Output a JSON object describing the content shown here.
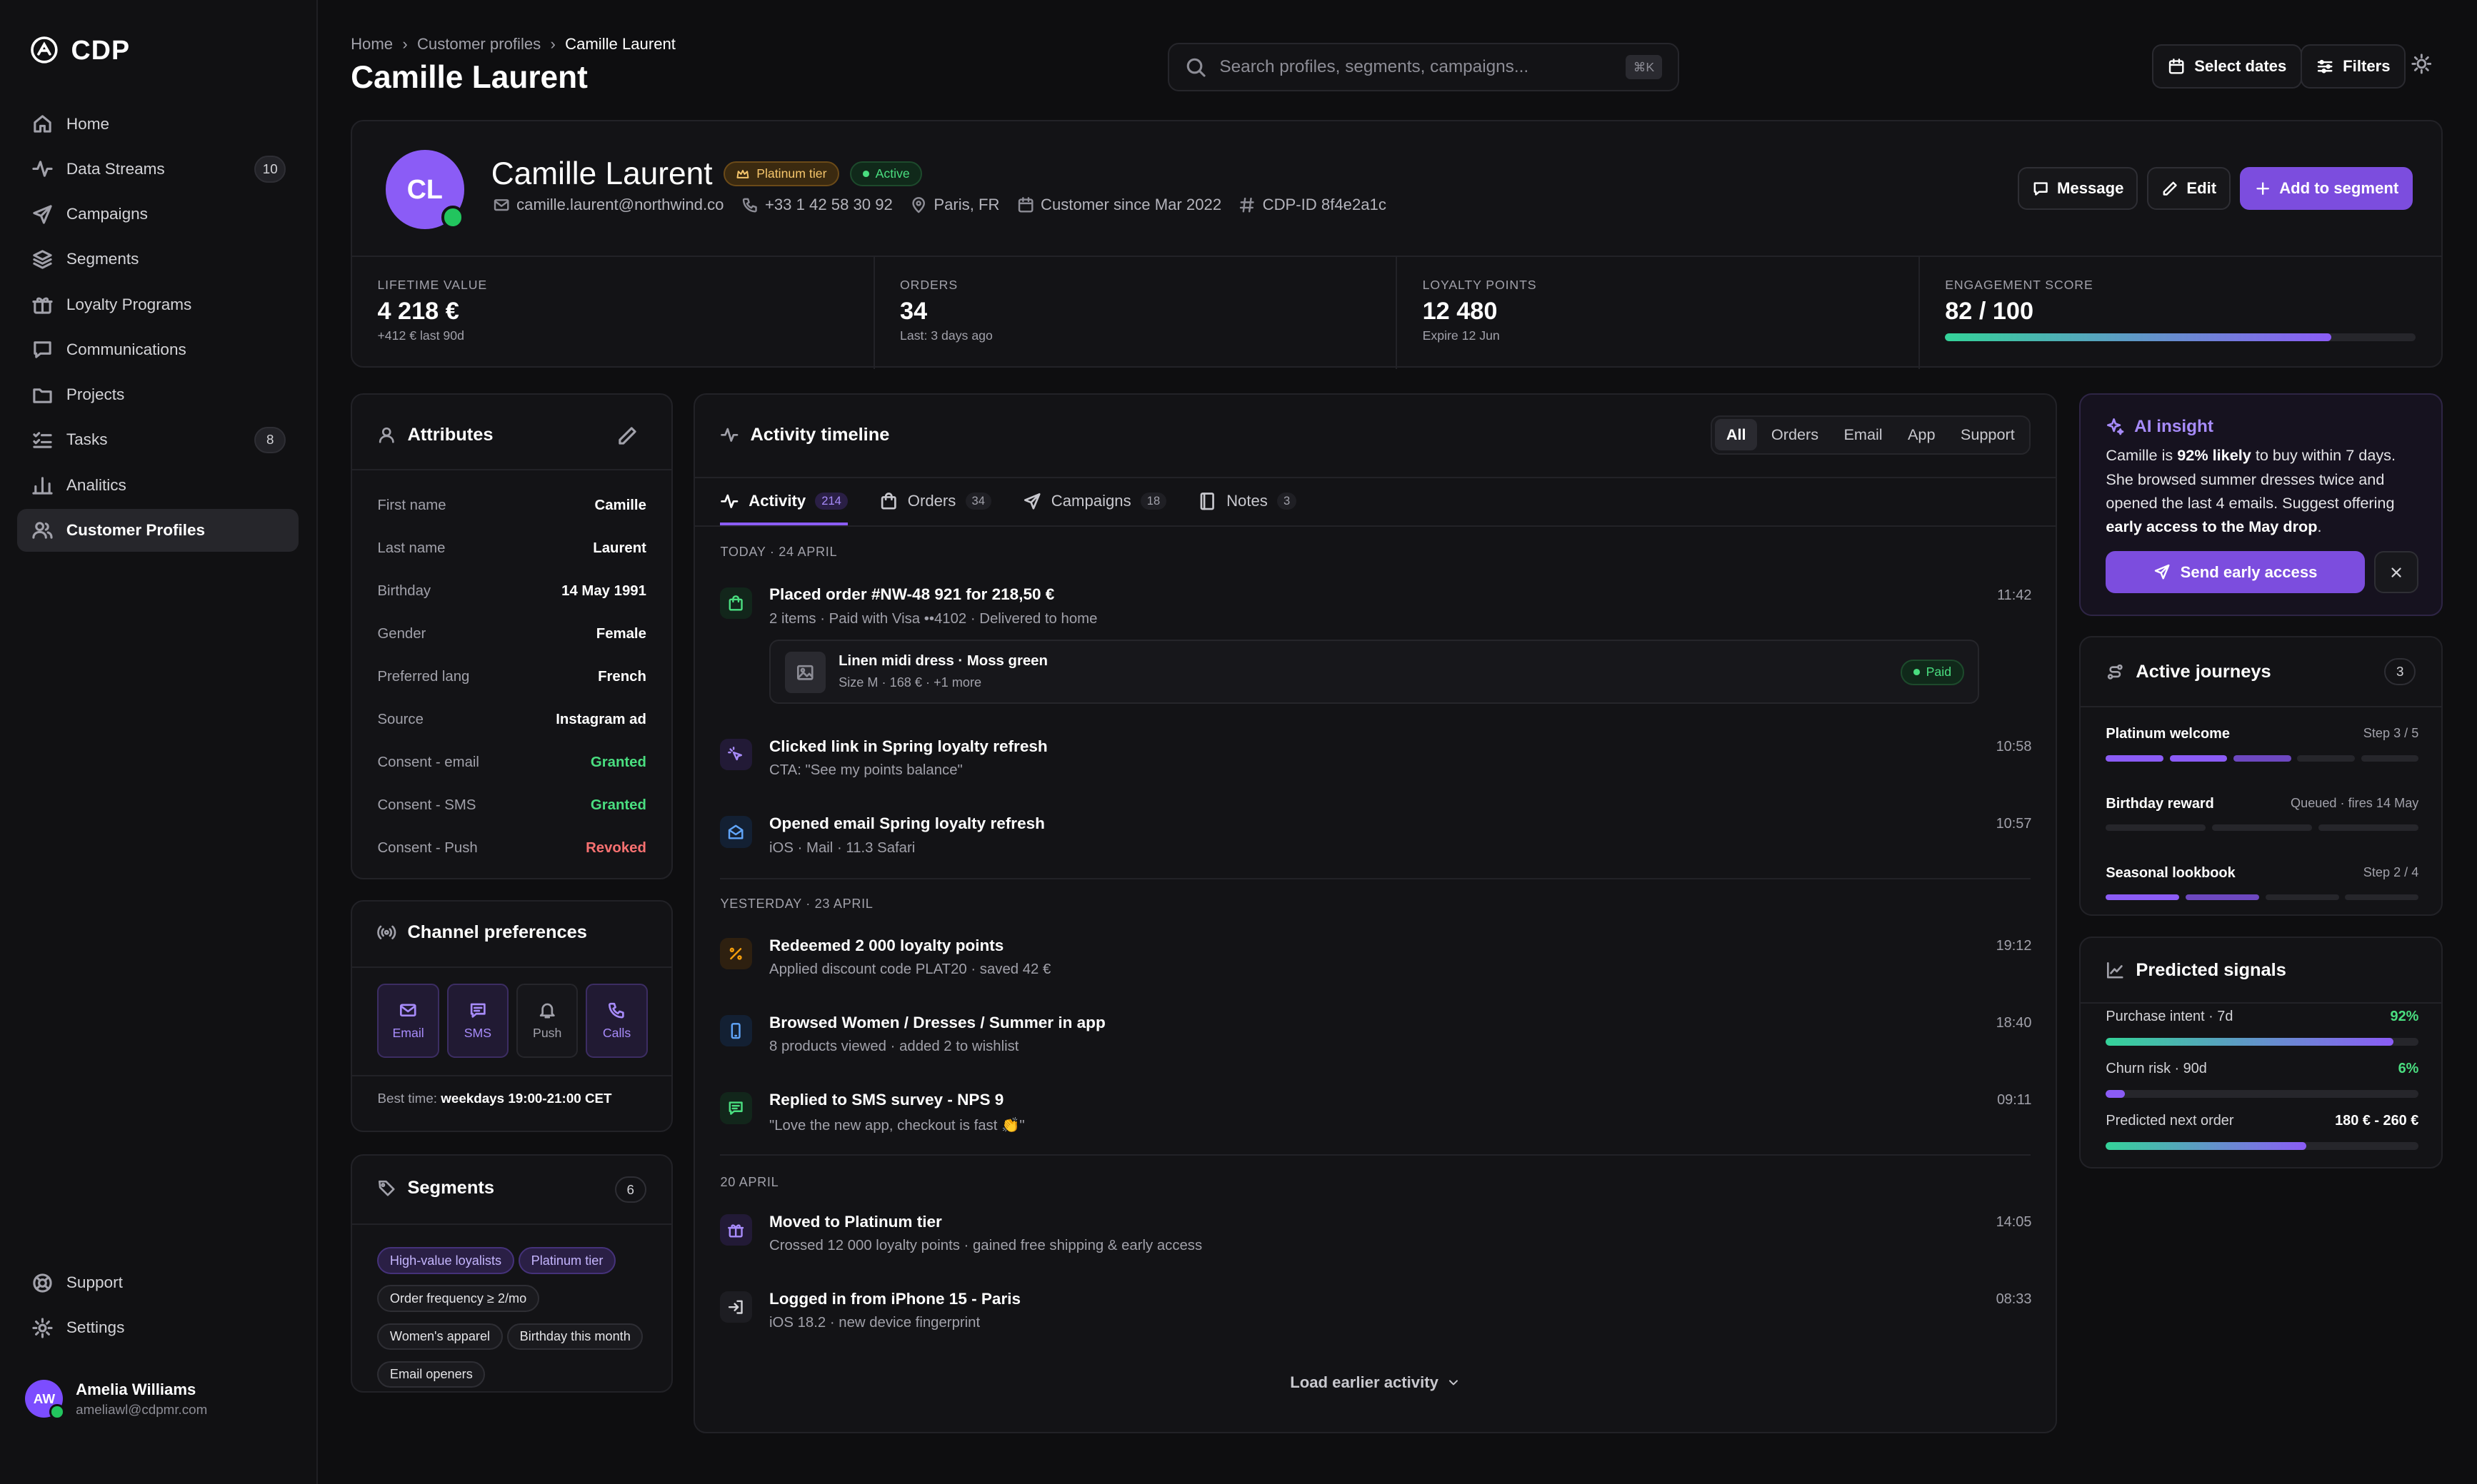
{
  "app": {
    "name": "CDP"
  },
  "sidebar": {
    "items": [
      {
        "label": "Home",
        "icon": "home-icon"
      },
      {
        "label": "Data Streams",
        "icon": "activity-icon",
        "badge": "10"
      },
      {
        "label": "Campaigns",
        "icon": "send-icon"
      },
      {
        "label": "Segments",
        "icon": "layers-icon"
      },
      {
        "label": "Loyalty Programs",
        "icon": "gift-icon"
      },
      {
        "label": "Communications",
        "icon": "message-icon"
      },
      {
        "label": "Projects",
        "icon": "folder-icon"
      },
      {
        "label": "Tasks",
        "icon": "list-check-icon",
        "badge": "8"
      },
      {
        "label": "Analitics",
        "icon": "bar-chart-icon"
      },
      {
        "label": "Customer Profiles",
        "icon": "users-icon",
        "active": true
      }
    ],
    "bottom": [
      {
        "label": "Support",
        "icon": "lifebuoy-icon"
      },
      {
        "label": "Settings",
        "icon": "gear-icon"
      }
    ],
    "user": {
      "initials": "AW",
      "name": "Amelia Williams",
      "email": "ameliawl@cdpmr.com"
    }
  },
  "header": {
    "breadcrumbs": [
      "Home",
      "Customer profiles",
      "Camille Laurent"
    ],
    "title": "Camille Laurent",
    "search_placeholder": "Search profiles, segments, campaigns...",
    "search_kbd": "⌘K",
    "select_dates": "Select dates",
    "filters": "Filters"
  },
  "profile": {
    "initials": "CL",
    "name": "Camille Laurent",
    "tier": "Platinum tier",
    "status": "Active",
    "email": "camille.laurent@northwind.co",
    "phone": "+33 1 42 58 30 92",
    "location": "Paris, FR",
    "since": "Customer since Mar 2022",
    "cdp_id": "CDP-ID 8f4e2a1c",
    "actions": {
      "message": "Message",
      "edit": "Edit",
      "add": "Add to segment"
    },
    "stats": [
      {
        "label": "LIFETIME VALUE",
        "value": "4 218 €",
        "sub": "+412 € last 90d"
      },
      {
        "label": "ORDERS",
        "value": "34",
        "sub": "Last: 3 days ago"
      },
      {
        "label": "LOYALTY POINTS",
        "value": "12 480",
        "sub": "Expire 12 Jun"
      },
      {
        "label": "ENGAGEMENT SCORE",
        "value": "82 / 100",
        "progress": 0.82
      }
    ]
  },
  "attributes": {
    "title": "Attributes",
    "rows": [
      {
        "k": "First name",
        "v": "Camille"
      },
      {
        "k": "Last name",
        "v": "Laurent"
      },
      {
        "k": "Birthday",
        "v": "14 May 1991"
      },
      {
        "k": "Gender",
        "v": "Female"
      },
      {
        "k": "Preferred lang",
        "v": "French"
      },
      {
        "k": "Source",
        "v": "Instagram ad"
      },
      {
        "k": "Consent - email",
        "v": "Granted",
        "color": "#4ade80"
      },
      {
        "k": "Consent - SMS",
        "v": "Granted",
        "color": "#4ade80"
      },
      {
        "k": "Consent - Push",
        "v": "Revoked",
        "color": "#f87171"
      }
    ]
  },
  "channels": {
    "title": "Channel preferences",
    "options": [
      {
        "label": "Email",
        "on": true
      },
      {
        "label": "SMS",
        "on": true
      },
      {
        "label": "Push",
        "on": false
      },
      {
        "label": "Calls",
        "on": true
      }
    ],
    "best_time_label": "Best time:",
    "best_time": "weekdays 19:00-21:00 CET"
  },
  "segments": {
    "title": "Segments",
    "count": "6",
    "tags": [
      {
        "label": "High-value loyalists",
        "purple": true
      },
      {
        "label": "Platinum tier",
        "purple": true
      },
      {
        "label": "Order frequency ≥ 2/mo"
      },
      {
        "label": "Women's apparel"
      },
      {
        "label": "Birthday this month"
      },
      {
        "label": "Email openers"
      }
    ]
  },
  "timeline": {
    "title": "Activity timeline",
    "filters": [
      "All",
      "Orders",
      "Email",
      "App",
      "Support"
    ],
    "tabs": [
      {
        "label": "Activity",
        "count": "214"
      },
      {
        "label": "Orders",
        "count": "34"
      },
      {
        "label": "Campaigns",
        "count": "18"
      },
      {
        "label": "Notes",
        "count": "3"
      }
    ],
    "days": [
      "TODAY · 24 APRIL",
      "YESTERDAY · 23 APRIL",
      "20 APRIL"
    ],
    "events": [
      {
        "title": "Placed order #NW-48 921 for 218,50 €",
        "sub": "2 items · Paid with Visa ••4102 · Delivered to home",
        "time": "11:42"
      },
      {
        "title": "Clicked link in Spring loyalty refresh",
        "sub": "CTA: \"See my points balance\"",
        "time": "10:58"
      },
      {
        "title": "Opened email Spring loyalty refresh",
        "sub": "iOS · Mail · 11.3 Safari",
        "time": "10:57"
      },
      {
        "title": "Redeemed 2 000 loyalty points",
        "sub": "Applied discount code PLAT20 · saved 42 €",
        "time": "19:12"
      },
      {
        "title": "Browsed Women / Dresses / Summer in app",
        "sub": "8 products viewed · added 2 to wishlist",
        "time": "18:40"
      },
      {
        "title": "Replied to SMS survey - NPS 9",
        "sub": "\"Love the new app, checkout is fast 👏\"",
        "time": "09:11"
      },
      {
        "title": "Moved to Platinum tier",
        "sub": "Crossed 12 000 loyalty points · gained free shipping & early access",
        "time": "14:05"
      },
      {
        "title": "Logged in from iPhone 15 - Paris",
        "sub": "iOS 18.2 · new device fingerprint",
        "time": "08:33"
      }
    ],
    "order_item": {
      "name": "Linen midi dress · Moss green",
      "detail": "Size M · 168 € · +1 more",
      "status": "Paid"
    },
    "load_more": "Load earlier activity"
  },
  "ai": {
    "title": "AI insight",
    "t1": "Camille is ",
    "b1": "92% likely",
    "t2": " to buy within 7 days. She browsed summer dresses twice and opened the last 4 emails. Suggest offering ",
    "b2": "early access to the May drop",
    "t3": ".",
    "button": "Send early access"
  },
  "journeys": {
    "title": "Active journeys",
    "count": "3",
    "items": [
      {
        "name": "Platinum welcome",
        "step": "Step 3 / 5"
      },
      {
        "name": "Birthday reward",
        "step": "Queued · fires 14 May"
      },
      {
        "name": "Seasonal lookbook",
        "step": "Step 2 / 4"
      }
    ]
  },
  "predicted": {
    "title": "Predicted signals",
    "rows": [
      {
        "label": "Purchase intent · 7d",
        "value": "92%",
        "fraction": 0.92,
        "color": "#4ade80"
      },
      {
        "label": "Churn risk · 90d",
        "value": "6%",
        "fraction": 0.06,
        "color": "#4ade80"
      },
      {
        "label": "Predicted next order",
        "value": "180 € - 260 €",
        "fraction": 0.64,
        "color": "#ffffff"
      }
    ]
  }
}
